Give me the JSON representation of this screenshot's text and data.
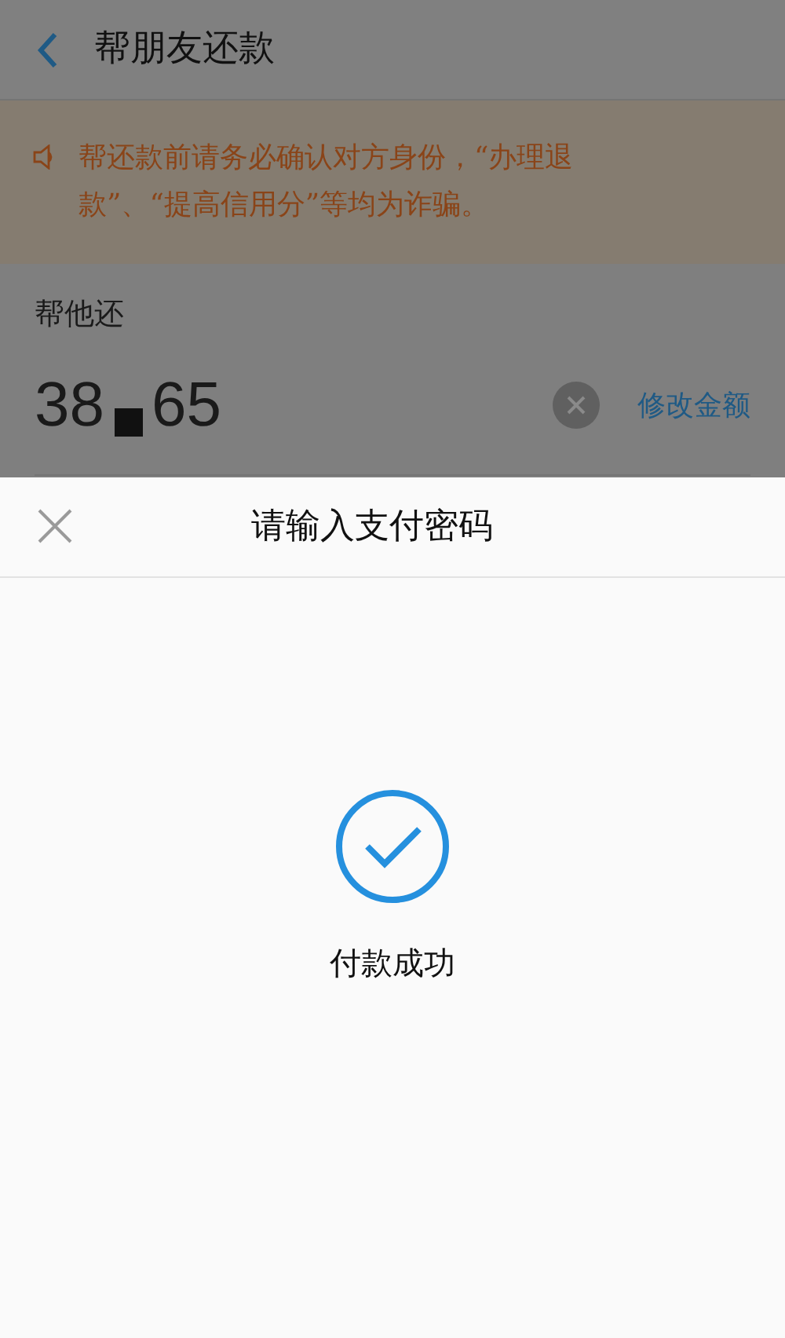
{
  "header": {
    "title": "帮朋友还款"
  },
  "notice": {
    "text": "帮还款前请务必确认对方身份，“办理退款”、“提高信用分”等均为诈骗。"
  },
  "repay": {
    "label": "帮他还",
    "amount_start": "38",
    "amount_end": "65",
    "redacted": true,
    "edit_link": "修改金额"
  },
  "sheet": {
    "title": "请输入支付密码",
    "status": "付款成功"
  }
}
